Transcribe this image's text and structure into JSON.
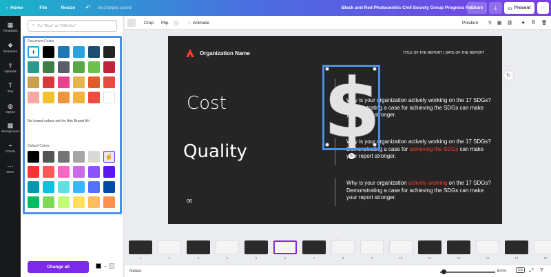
{
  "topbar": {
    "home": "Home",
    "file": "File",
    "resize": "Resize",
    "saved": "All changes saved",
    "title": "Black and Red Photocentric Civil Society Group Progress Re...",
    "share": "Share",
    "present": "Present"
  },
  "rail": [
    {
      "label": "Templates",
      "icon": "templates-icon"
    },
    {
      "label": "Elements",
      "icon": "elements-icon"
    },
    {
      "label": "Uploads",
      "icon": "uploads-icon"
    },
    {
      "label": "Text",
      "icon": "text-icon"
    },
    {
      "label": "Styles",
      "icon": "styles-icon"
    },
    {
      "label": "Background",
      "icon": "background-icon"
    },
    {
      "label": "Charts",
      "icon": "charts-icon"
    },
    {
      "label": "More",
      "icon": "more-icon"
    }
  ],
  "panel": {
    "search_placeholder": "Try \"Blue\" or \"#00c4cc\"",
    "document_colors_label": "Document Colors",
    "no_brand": "No brand colors set for this Brand Kit",
    "default_colors_label": "Default Colors",
    "change_all": "Change all",
    "document_colors": [
      "#000000",
      "#1d78b6",
      "#2aa2dc",
      "#1d4f73",
      "#242424",
      "#2a9b8e",
      "#3f7f46",
      "#5b5e66",
      "#58a845",
      "#6dc14d",
      "#c0243c",
      "#c9a14a",
      "#d63a3f",
      "#ec3f8b",
      "#e6b24d",
      "#e45b2a",
      "#e84a3f",
      "#f4a8a0",
      "#f2c12e",
      "#f0953c",
      "#f4b33e",
      "#f04b3f",
      "#ffffff"
    ],
    "default_colors": [
      "#000000",
      "#545454",
      "#737373",
      "#a6a6a6",
      "#d9d9d9",
      "#ffffff",
      "#ff3131",
      "#ff5757",
      "#ff66c4",
      "#cb6ce6",
      "#8c52ff",
      "#5e17eb",
      "#0097b2",
      "#0cc0df",
      "#5ce1e6",
      "#38b6ff",
      "#5271ff",
      "#004aad",
      "#00bf63",
      "#7ed957",
      "#c1ff72",
      "#ffde59",
      "#ffbd59",
      "#ff914d"
    ]
  },
  "toolbar": {
    "crop": "Crop",
    "flip": "Flip",
    "animate": "Animate",
    "position": "Position"
  },
  "slide": {
    "org_name": "Organization Name",
    "report_title": "TITLE OF THE REPORT | DATE OF THE REPORT",
    "cost": "Cost",
    "quality": "Quality",
    "page": "06",
    "p1": "Why is your organization actively working on the 17 SDGs? Demonstrating a case for achieving the SDGs can make your report stronger.",
    "p2a": "Why is your organization actively working on the 17 SDGs? Demonstrating a case for ",
    "p2red1": "achieving the",
    "p2b": " ",
    "p2red2": "SDGs",
    "p2c": " can make your report stronger.",
    "p3a": "Why is your organization ",
    "p3red": "actively working",
    "p3b": " on the 17 SDGs? Demonstrating a case for achieving the SDGs can make your report stronger.",
    "dollar_glyph": "$",
    "accent": "#ff3b2f"
  },
  "filmstrip": [
    "1",
    "2",
    "3",
    "4",
    "5",
    "6",
    "7",
    "8",
    "9",
    "10",
    "11",
    "12",
    "13",
    "14",
    "15"
  ],
  "bottombar": {
    "notes": "Notes",
    "zoom": "61%",
    "pages": "15"
  }
}
